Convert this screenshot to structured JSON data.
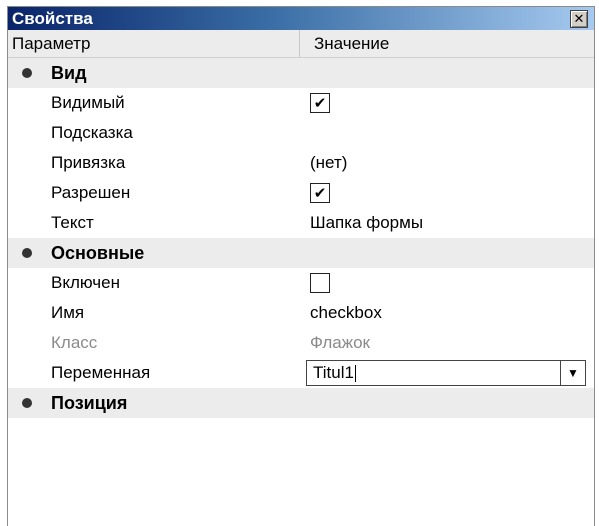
{
  "window": {
    "title": "Свойства",
    "close_symbol": "✕"
  },
  "columns": {
    "param": "Параметр",
    "value": "Значение"
  },
  "sections": {
    "vid": {
      "title": "Вид",
      "visible_label": "Видимый",
      "visible_checked": true,
      "hint_label": "Подсказка",
      "hint_value": "",
      "anchor_label": "Привязка",
      "anchor_value": "(нет)",
      "enabled_label": "Разрешен",
      "enabled_checked": true,
      "text_label": "Текст",
      "text_value": "Шапка формы"
    },
    "osnovnye": {
      "title": "Основные",
      "on_label": "Включен",
      "on_checked": false,
      "name_label": "Имя",
      "name_value": "checkbox",
      "class_label": "Класс",
      "class_value": "Флажок",
      "variable_label": "Переменная",
      "variable_value": "Titul1"
    },
    "pozitsiya": {
      "title": "Позиция"
    }
  },
  "icons": {
    "check": "✔",
    "dropdown": "▼",
    "bullet": "category-bullet-icon"
  },
  "colors": {
    "title_start": "#0a246a",
    "title_end": "#a6caf0",
    "category_bg": "#ececec",
    "muted_text": "#8a8a8a"
  }
}
